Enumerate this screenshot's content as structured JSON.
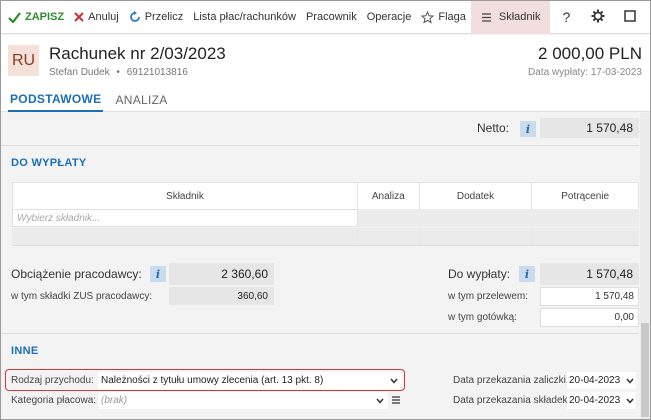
{
  "toolbar": {
    "save_label": "ZAPISZ",
    "cancel_label": "Anuluj",
    "recalc_label": "Przelicz",
    "lists_label": "Lista płac/rachunków",
    "employee_label": "Pracownik",
    "operations_label": "Operacje",
    "flag_label": "Flaga",
    "component_label": "Składnik",
    "help_label": "?"
  },
  "header": {
    "badge": "RU",
    "title": "Rachunek nr 2/03/2023",
    "person": "Stefan Dudek",
    "separator": "•",
    "person_id": "69121013816",
    "amount": "2 000,00 PLN",
    "payment_date": "Data wypłaty: 17-03-2023"
  },
  "tabs": [
    {
      "label": "PODSTAWOWE",
      "active": true
    },
    {
      "label": "ANALIZA",
      "active": false
    }
  ],
  "netto": {
    "label": "Netto:",
    "value": "1 570,48"
  },
  "payout_section": {
    "title": "DO WYPŁATY",
    "columns": [
      "Składnik",
      "Analiza",
      "Dodatek",
      "Potrącenie"
    ],
    "placeholder": "Wybierz składnik..."
  },
  "employer_burden": {
    "label": "Obciążenie pracodawcy:",
    "value": "2 360,60",
    "zus_label": "w tym składki ZUS pracodawcy:",
    "zus_value": "360,60"
  },
  "to_pay": {
    "label": "Do wypłaty:",
    "value": "1 570,48",
    "transfer_label": "w tym przelewem:",
    "transfer_value": "1 570,48",
    "cash_label": "w tym gotówką:",
    "cash_value": "0,00"
  },
  "other_section": {
    "title": "INNE",
    "income_type_label": "Rodzaj przychodu:",
    "income_type_value": "Należności z tytułu umowy zlecenia (art. 13 pkt. 8)",
    "pay_category_label": "Kategoria płacowa:",
    "pay_category_value": "(brak)",
    "advance_date_label": "Data przekazania zaliczki:",
    "advance_date_value": "20-04-2023",
    "contrib_date_label": "Data przekazania składek:",
    "contrib_date_value": "20-04-2023"
  },
  "colors": {
    "accent": "#1a6fb5",
    "save_green": "#2e8b2e",
    "cancel_red": "#d03030",
    "highlight_red": "#cc3b3b"
  }
}
